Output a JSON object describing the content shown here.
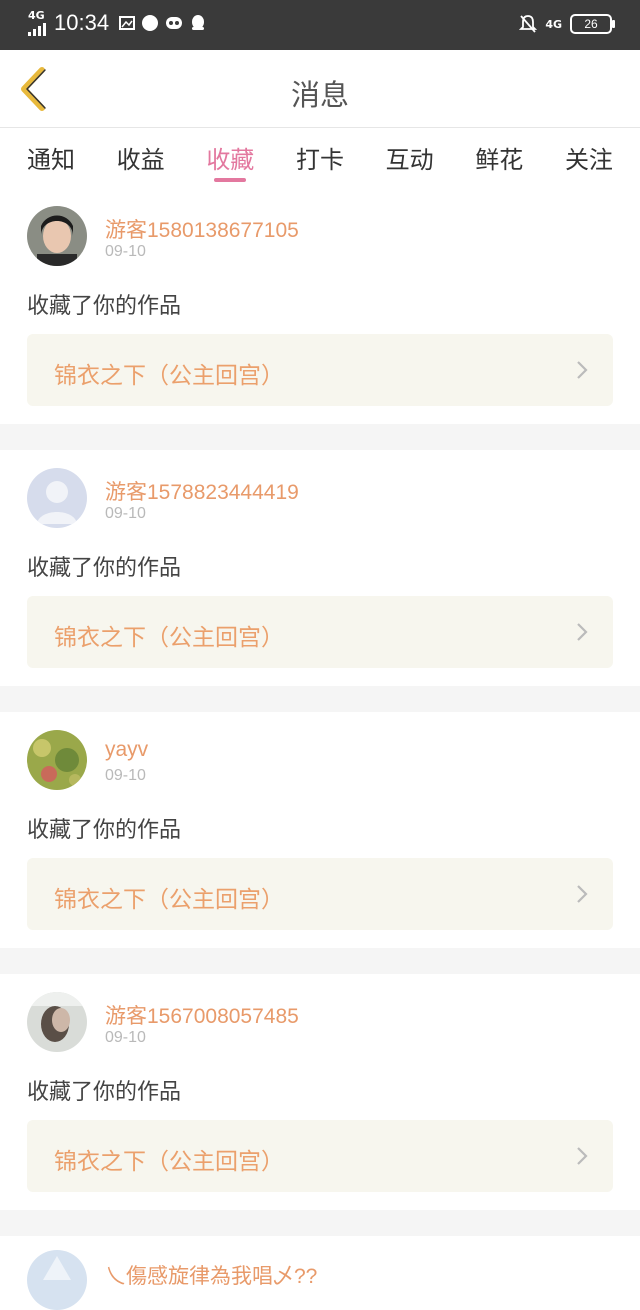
{
  "status": {
    "network_left": "4G",
    "time": "10:34",
    "network_right": "4G",
    "battery": "26"
  },
  "header": {
    "title": "消息"
  },
  "tabs": [
    {
      "label": "通知"
    },
    {
      "label": "收益"
    },
    {
      "label": "收藏"
    },
    {
      "label": "打卡"
    },
    {
      "label": "互动"
    },
    {
      "label": "鲜花"
    },
    {
      "label": "关注"
    }
  ],
  "active_tab": "收藏",
  "items": [
    {
      "user": "游客1580138677105",
      "date": "09-10",
      "action": "收藏了你的作品",
      "work": "锦衣之下（公主回宫）"
    },
    {
      "user": "游客1578823444419",
      "date": "09-10",
      "action": "收藏了你的作品",
      "work": "锦衣之下（公主回宫）"
    },
    {
      "user": "yayv",
      "date": "09-10",
      "action": "收藏了你的作品",
      "work": "锦衣之下（公主回宫）"
    },
    {
      "user": "游客1567008057485",
      "date": "09-10",
      "action": "收藏了你的作品",
      "work": "锦衣之下（公主回宫）"
    },
    {
      "user": "乀傷感旋律為我唱乄??"
    }
  ],
  "colors": {
    "accent": "#e3789f",
    "username": "#e89a6a",
    "work_bg": "#f7f6ee",
    "back_icon": "#e8b93c"
  }
}
